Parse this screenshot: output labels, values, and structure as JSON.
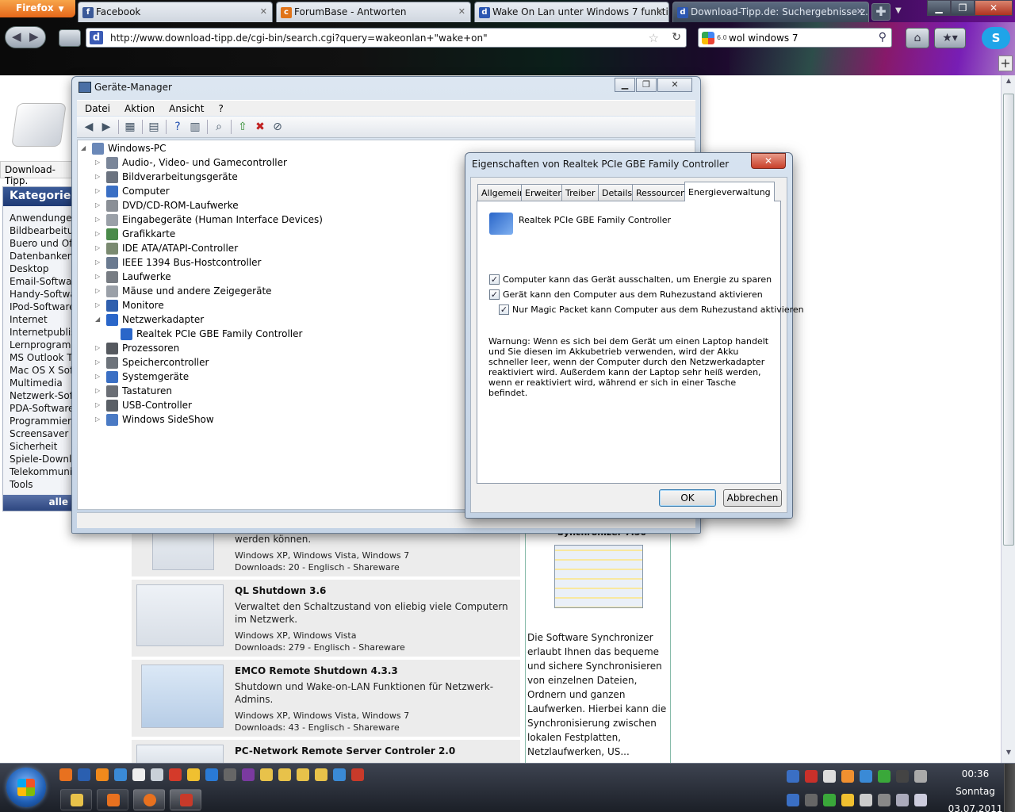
{
  "browser": {
    "menu_button": "Firefox",
    "tabs": [
      {
        "label": "Facebook",
        "icon_color": "#3b5998",
        "icon_letter": "f"
      },
      {
        "label": "ForumBase - Antworten",
        "icon_color": "#e0741a",
        "icon_letter": "c"
      },
      {
        "label": "Wake On Lan unter Windows 7 funkti...",
        "icon_color": "#2c57b2",
        "icon_letter": "d"
      },
      {
        "label": "Download-Tipp.de: Suchergebnisse z...",
        "icon_color": "#2c57b2",
        "icon_letter": "d"
      }
    ],
    "url": "http://www.download-tipp.de/cgi-bin/search.cgi?query=wakeonlan+\"wake+on\"",
    "search_engine_version": "6.0",
    "search_text": "wol windows 7"
  },
  "page": {
    "logo_text": "Download-Tipp.",
    "categories_title": "Kategorien",
    "categories": [
      "Anwendungen",
      "Bildbearbeitung",
      "Buero und Office",
      "Datenbanken",
      "Desktop",
      "Email-Software",
      "Handy-Software",
      "IPod-Software",
      "Internet",
      "Internetpublishing",
      "Lernprogramme",
      "MS Outlook Tools",
      "Mac OS X Software",
      "Multimedia",
      "Netzwerk-Software",
      "PDA-Software",
      "Programmierung",
      "Screensaver",
      "Sicherheit",
      "Spiele-Downloads",
      "Telekommunikation",
      "Tools"
    ],
    "categories_all": "alle",
    "results": [
      {
        "title": "",
        "desc": "werden können.",
        "os": "Windows XP, Windows Vista, Windows 7",
        "downloads": "Downloads: 20 - Englisch - Shareware"
      },
      {
        "title": "QL Shutdown 3.6",
        "desc": "Verwaltet den Schaltzustand von eliebig viele Computern im Netzwerk.",
        "os": "Windows XP, Windows Vista",
        "downloads": "Downloads: 279 - Englisch - Shareware"
      },
      {
        "title": "EMCO Remote Shutdown 4.3.3",
        "desc": "Shutdown und Wake-on-LAN Funktionen für Netzwerk-Admins.",
        "os": "Windows XP, Windows Vista, Windows 7",
        "downloads": "Downloads: 43 - Englisch - Shareware"
      },
      {
        "title": "PC-Network Remote Server Controler 2.0",
        "desc": "",
        "os": "",
        "downloads": ""
      }
    ],
    "promo": {
      "title": "Synchronizer 7.50",
      "text": "Die Software Synchronizer erlaubt Ihnen das bequeme und sichere Synchronisieren von einzelnen Dateien, Ordnern und ganzen Laufwerken. Hierbei kann die Synchronisierung zwischen lokalen Festplatten, Netzlaufwerken, US..."
    }
  },
  "device_manager": {
    "title": "Geräte-Manager",
    "menu": [
      "Datei",
      "Aktion",
      "Ansicht",
      "?"
    ],
    "root": "Windows-PC",
    "nodes": [
      {
        "label": "Audio-, Video- und Gamecontroller",
        "icon": "speaker-icon",
        "color": "#7a8699"
      },
      {
        "label": "Bildverarbeitungsgeräte",
        "icon": "camera-icon",
        "color": "#6b7380"
      },
      {
        "label": "Computer",
        "icon": "computer-icon",
        "color": "#3a6fc4"
      },
      {
        "label": "DVD/CD-ROM-Laufwerke",
        "icon": "disc-drive-icon",
        "color": "#8a8f96"
      },
      {
        "label": "Eingabegeräte (Human Interface Devices)",
        "icon": "hid-icon",
        "color": "#9aa0a8"
      },
      {
        "label": "Grafikkarte",
        "icon": "display-adapter-icon",
        "color": "#4a8a4a"
      },
      {
        "label": "IDE ATA/ATAPI-Controller",
        "icon": "ide-icon",
        "color": "#7a8a70"
      },
      {
        "label": "IEEE 1394 Bus-Hostcontroller",
        "icon": "firewire-icon",
        "color": "#6a7a90"
      },
      {
        "label": "Laufwerke",
        "icon": "disk-icon",
        "color": "#777c83"
      },
      {
        "label": "Mäuse und andere Zeigegeräte",
        "icon": "mouse-icon",
        "color": "#9aa0a8"
      },
      {
        "label": "Monitore",
        "icon": "monitor-icon",
        "color": "#2f5fae"
      },
      {
        "label": "Netzwerkadapter",
        "icon": "network-icon",
        "color": "#2a66c9",
        "expanded": true
      },
      {
        "label": "Realtek PCIe GBE Family Controller",
        "icon": "network-card-icon",
        "color": "#2a66c9",
        "child": true
      },
      {
        "label": "Prozessoren",
        "icon": "processor-icon",
        "color": "#55595f"
      },
      {
        "label": "Speichercontroller",
        "icon": "storage-icon",
        "color": "#6d737b"
      },
      {
        "label": "Systemgeräte",
        "icon": "system-icon",
        "color": "#3a6fc4"
      },
      {
        "label": "Tastaturen",
        "icon": "keyboard-icon",
        "color": "#6a6e75"
      },
      {
        "label": "USB-Controller",
        "icon": "usb-icon",
        "color": "#5a5f66"
      },
      {
        "label": "Windows SideShow",
        "icon": "sideshow-icon",
        "color": "#4a7ac4"
      }
    ]
  },
  "properties": {
    "title": "Eigenschaften von Realtek PCIe GBE Family Controller",
    "tabs": [
      "Allgemein",
      "Erweitert",
      "Treiber",
      "Details",
      "Ressourcen",
      "Energieverwaltung"
    ],
    "device_name": "Realtek PCIe GBE Family Controller",
    "check1": "Computer kann das Gerät ausschalten, um Energie zu sparen",
    "check2": "Gerät kann den Computer aus dem Ruhezustand aktivieren",
    "check3": "Nur Magic Packet kann Computer aus dem Ruhezustand aktivieren",
    "warning": "Warnung: Wenn es sich bei dem Gerät um einen Laptop handelt und Sie diesen im Akkubetrieb verwenden, wird der Akku schneller leer, wenn der Computer durch den Netzwerkadapter reaktiviert wird. Außerdem kann der Laptop sehr heiß werden, wenn er reaktiviert wird, während er sich in einer Tasche befindet.",
    "ok": "OK",
    "cancel": "Abbrechen"
  },
  "taskbar": {
    "time": "00:36",
    "day": "Sonntag",
    "date": "03.07.2011"
  }
}
